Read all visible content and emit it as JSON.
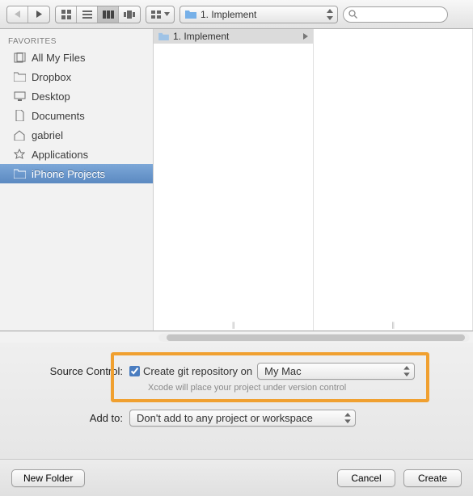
{
  "toolbar": {
    "path_label": "1. Implement",
    "search_placeholder": ""
  },
  "sidebar": {
    "header": "FAVORITES",
    "items": [
      {
        "label": "All My Files",
        "icon": "all-files-icon"
      },
      {
        "label": "Dropbox",
        "icon": "folder-icon"
      },
      {
        "label": "Desktop",
        "icon": "desktop-icon"
      },
      {
        "label": "Documents",
        "icon": "documents-icon"
      },
      {
        "label": "gabriel",
        "icon": "home-icon"
      },
      {
        "label": "Applications",
        "icon": "applications-icon"
      },
      {
        "label": "iPhone Projects",
        "icon": "folder-icon",
        "selected": true
      }
    ]
  },
  "columns": {
    "col1_item": "1. Implement"
  },
  "options": {
    "source_control_label": "Source Control:",
    "git_checkbox_label": "Create git repository on",
    "git_checked": true,
    "git_location": "My Mac",
    "git_hint": "Xcode will place your project under version control",
    "addto_label": "Add to:",
    "addto_value": "Don't add to any project or workspace"
  },
  "footer": {
    "new_folder": "New Folder",
    "cancel": "Cancel",
    "create": "Create"
  }
}
